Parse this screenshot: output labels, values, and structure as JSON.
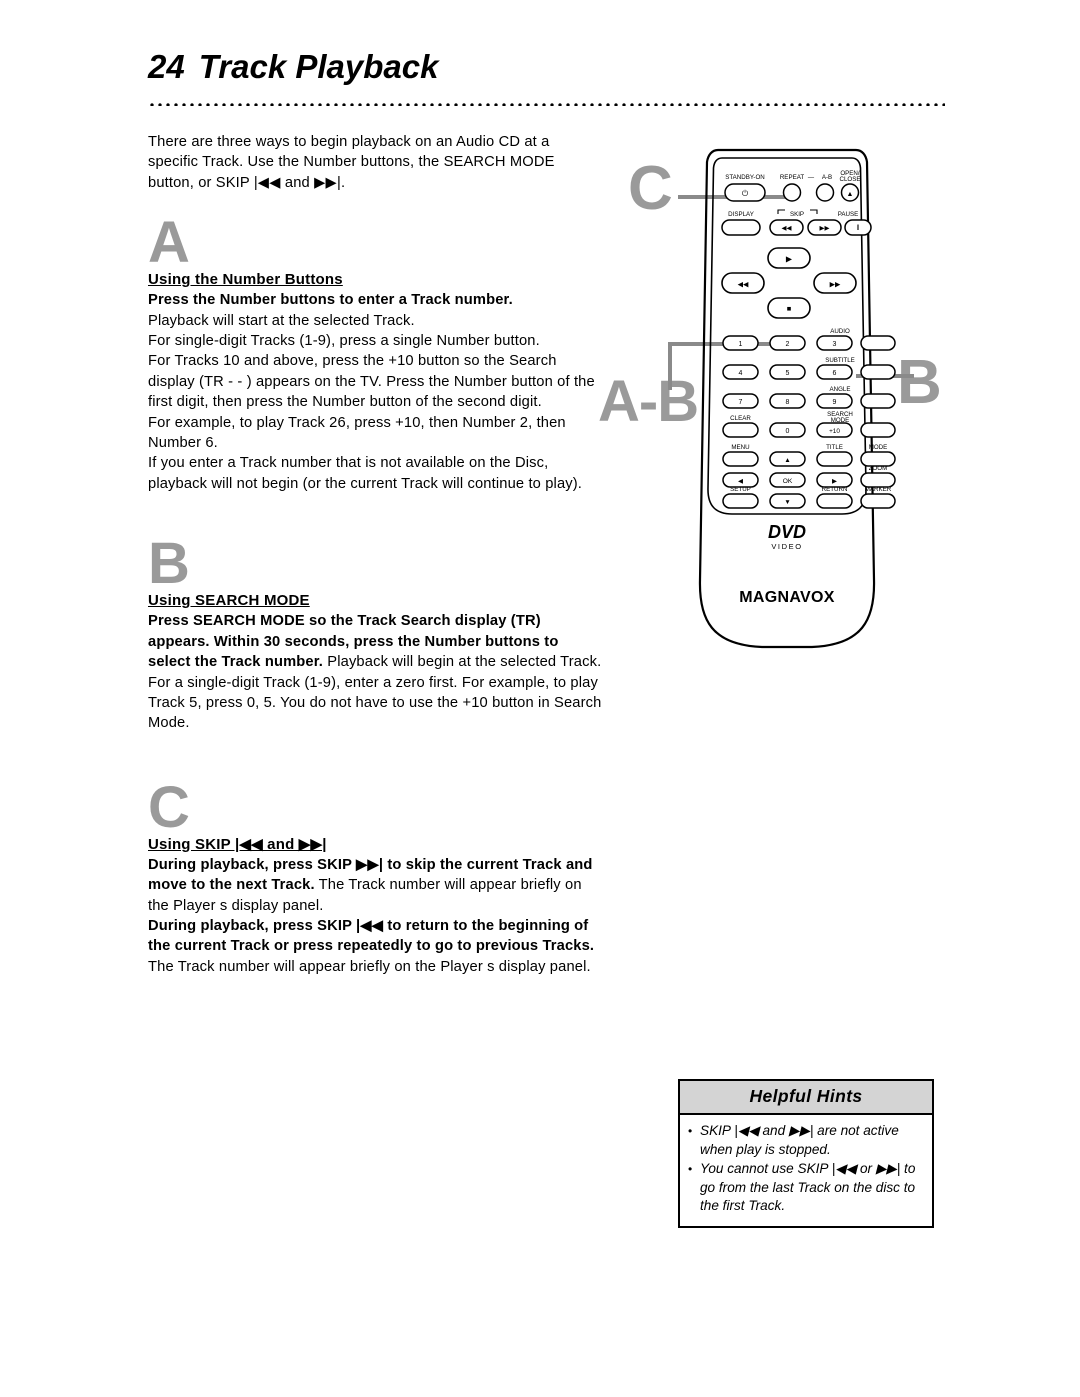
{
  "page": {
    "number": "24",
    "title": "Track Playback"
  },
  "intro": "There are three ways to begin playback on an Audio CD at a specific Track. Use the Number buttons, the SEARCH MODE button, or SKIP |◀◀ and ▶▶|.",
  "sections": [
    {
      "letter": "A",
      "heading": "Using the Number Buttons",
      "bold_lead": "Press the Number buttons to enter a Track number.",
      "paragraphs": [
        "Playback will start at the selected Track.",
        "For single-digit Tracks (1-9), press a single Number button.",
        "For Tracks 10 and above, press the +10 button so the Search display (TR - - ) appears on the TV. Press the Number button of the first digit, then press the Number button of the second digit.",
        "For example, to play Track 26, press +10, then Number 2, then Number 6.",
        "If you enter a Track number that is not available on the Disc, playback will not begin (or the current Track will continue to play)."
      ]
    },
    {
      "letter": "B",
      "heading": "Using SEARCH MODE",
      "bold_lead": "Press SEARCH MODE so the Track Search display (TR) appears. Within 30 seconds, press the Number buttons to select the Track number.",
      "trailing": " Playback will begin at the selected Track. For a single-digit Track (1-9), enter a zero first. For example, to play Track 5, press 0, 5. You do not have to use the +10 button in Search Mode."
    },
    {
      "letter": "C",
      "heading": "Using SKIP |◀◀ and ▶▶|",
      "bold_lead_1": "During playback, press SKIP ▶▶| to skip the current Track and move to the next Track.",
      "trailing_1": " The Track number will appear briefly on the Player s display panel.",
      "bold_lead_2": "During playback, press SKIP |◀◀ to return to the beginning of the current Track or press repeatedly to go to previous Tracks.",
      "trailing_2": " The Track number will appear briefly on the Player s display panel."
    }
  ],
  "callouts": {
    "c": "C",
    "ab": "A-B",
    "b": "B"
  },
  "helpful_hints": {
    "header": "Helpful Hints",
    "bullet_char": "•",
    "items": [
      "SKIP |◀◀ and ▶▶| are not active when play is stopped.",
      "You cannot use SKIP |◀◀ or ▶▶| to go from the last Track on the disc to the first Track."
    ]
  },
  "remote": {
    "brand": "MAGNAVOX",
    "logo_main": "DVD",
    "logo_sub": "VIDEO",
    "labels": {
      "standby": "STANDBY-ON",
      "repeat": "REPEAT",
      "repeat_dash": "—",
      "ab": "A-B",
      "open_close_1": "OPEN/",
      "open_close_2": "CLOSE",
      "display": "DISPLAY",
      "skip": "SKIP",
      "pause": "PAUSE",
      "audio": "AUDIO",
      "subtitle": "SUBTITLE",
      "angle": "ANGLE",
      "search_mode_1": "SEARCH",
      "search_mode_2": "MODE",
      "clear": "CLEAR",
      "menu": "MENU",
      "title": "TITLE",
      "mode": "MODE",
      "zoom": "ZOOM",
      "setup": "SETUP",
      "return": "RETURN",
      "marker": "MARKER",
      "ok": "OK"
    },
    "keypad": [
      "1",
      "2",
      "3",
      "4",
      "5",
      "6",
      "7",
      "8",
      "9",
      "0",
      "+10"
    ],
    "glyphs": {
      "power": "⏻",
      "eject": "▲",
      "skip_prev": "◀◀",
      "skip_next": "▶▶",
      "pause": "‖",
      "play": "▶",
      "stop": "■",
      "rew": "◀◀",
      "ff": "▶▶",
      "up": "▲",
      "down": "▼",
      "left": "◀",
      "right": "▶"
    }
  }
}
